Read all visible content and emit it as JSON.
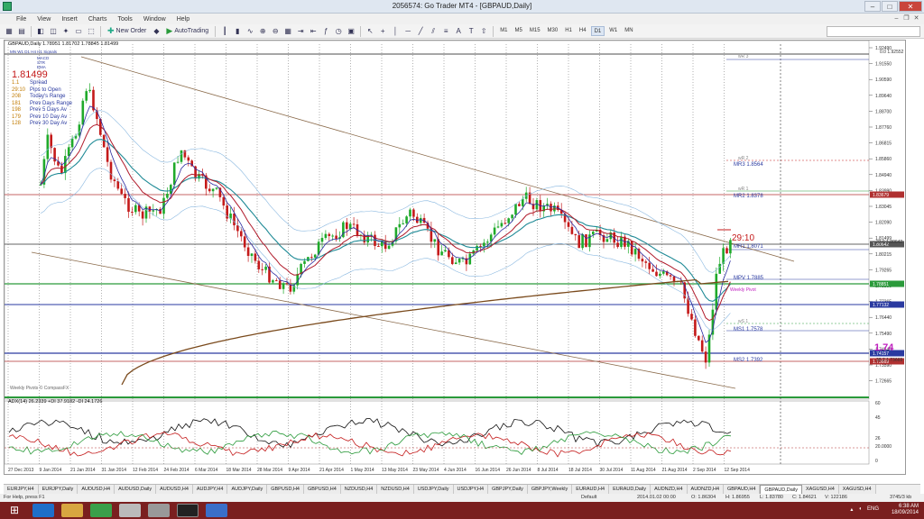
{
  "window": {
    "title": "2056574: Go Trader MT4 - [GBPAUD,Daily]"
  },
  "menu": [
    "File",
    "View",
    "Insert",
    "Charts",
    "Tools",
    "Window",
    "Help"
  ],
  "toolbar": {
    "new_order": "New Order",
    "autotrading": "AutoTrading",
    "timeframes": [
      "M1",
      "M5",
      "M15",
      "M30",
      "H1",
      "H4",
      "D1",
      "W1",
      "MN"
    ],
    "active_timeframe": "D1"
  },
  "chart": {
    "header": "GBPAUD,Daily  1.78951 1.81702 1.78845 1.81499",
    "mini_tfs": "MN W1 D1 H4 H1 Signals",
    "mini_inds": [
      "MACD",
      "STR",
      "EMA"
    ],
    "price_big": "1.81499",
    "info_rows": [
      {
        "num": "1.1",
        "label": "Spread"
      },
      {
        "num": "29:10",
        "label": "Pips to Open"
      },
      {
        "num": "208",
        "label": "Today's Range"
      },
      {
        "num": "181",
        "label": "Prev Days Range"
      },
      {
        "num": "198",
        "label": "Prev 5 Days Av"
      },
      {
        "num": "179",
        "label": "Prev 10 Day Av"
      },
      {
        "num": "128",
        "label": "Prev 30 Day Av"
      }
    ],
    "countdown": "29:10",
    "weekly_pivots_label": "Weekly Pivots © CompassFX",
    "levels": {
      "wr3": "wR 3",
      "fib0": "0.0 1.92552",
      "wr2": "wR 2",
      "mr3": "MR3  1.8564",
      "wr1": "wR 1",
      "mr2": "MR2  1.8378",
      "mr1": "MR1  1.8071",
      "fib236": "23.6 1.80642",
      "mpv": "MPV  1.7885",
      "weekly_pivot": "Weekly Pivot",
      "ws1": "wS 1",
      "ms1": "MS1  1.7578",
      "big_level": "1.74",
      "ms2": "MS2  1.7392",
      "fib382": "38.2 1.73669"
    },
    "y_ticks": [
      "1.92490",
      "1.91550",
      "1.90590",
      "1.89640",
      "1.88700",
      "1.87760",
      "1.86815",
      "1.85860",
      "1.84940",
      "1.83990",
      "1.83045",
      "1.82090",
      "1.81499",
      "1.80215",
      "1.79265",
      "1.78300",
      "1.77365",
      "1.76440",
      "1.75490",
      "1.74540",
      "1.73590",
      "1.72665"
    ],
    "price_markers": [
      {
        "text": "1.83679",
        "color": "#b03030"
      },
      {
        "text": "1.80642",
        "color": "#555555"
      },
      {
        "text": "1.78851",
        "color": "#2a9a3a"
      },
      {
        "text": "1.77132",
        "color": "#2a3aa0"
      },
      {
        "text": "1.74157",
        "color": "#2a3aa0"
      },
      {
        "text": "1.73669",
        "color": "#b03030"
      }
    ],
    "adx_label": "ADX(14) 26.2339  +DI 37.9182  -DI 24.1726",
    "adx_ticks": [
      "60",
      "45",
      "26",
      "20.0000",
      "0"
    ],
    "x_dates": [
      "27 Dec 2013",
      "9 Jan 2014",
      "21 Jan 2014",
      "31 Jan 2014",
      "12 Feb 2014",
      "24 Feb 2014",
      "6 Mar 2014",
      "18 Mar 2014",
      "28 Mar 2014",
      "9 Apr 2014",
      "21 Apr 2014",
      "1 May 2014",
      "13 May 2014",
      "23 May 2014",
      "4 Jun 2014",
      "16 Jun 2014",
      "26 Jun 2014",
      "8 Jul 2014",
      "18 Jul 2014",
      "30 Jul 2014",
      "11 Aug 2014",
      "21 Aug 2014",
      "2 Sep 2014",
      "12 Sep 2014"
    ]
  },
  "chart_tabs": [
    "EURJPY,H4",
    "EURJPY,Daily",
    "AUDUSD,H4",
    "AUDUSD,Daily",
    "AUDUSD,H4",
    "AUDJPY,H4",
    "AUDJPY,Daily",
    "GBPUSD,H4",
    "GBPUSD,H4",
    "NZDUSD,H4",
    "NZDUSD,H4",
    "USDJPY,Daily",
    "USDJPY,H4",
    "GBPJPY,Daily",
    "GBPJPY,Weekly",
    "EURAUD,H4",
    "EURAUD,Daily",
    "AUDNZD,H4",
    "AUDNZD,H4",
    "GBPAUD,H4",
    "GBPAUD,Daily",
    "XAGUSD,H4",
    "XAGUSD,H4"
  ],
  "active_tab": "GBPAUD,Daily",
  "status": {
    "help": "For Help, press F1",
    "profile": "Default",
    "dt": "2014.01.02 00:00",
    "o": "O: 1.86304",
    "h": "H: 1.86955",
    "l": "L: 1.83780",
    "c": "C: 1.84621",
    "v": "V: 122186",
    "traffic": "3745/3 kb"
  },
  "taskbar": {
    "lang": "ENG",
    "time": "6:38 AM",
    "date": "18/09/2014"
  },
  "colors": {
    "bull": "#1faa2a",
    "bear": "#c41a1a",
    "ema_red": "#c41a1a",
    "ema_teal": "#1f8a96",
    "ema_brown": "#7a4a1c",
    "bb_blue": "#8ab8e0",
    "taskbar": "#7a1f1f"
  }
}
